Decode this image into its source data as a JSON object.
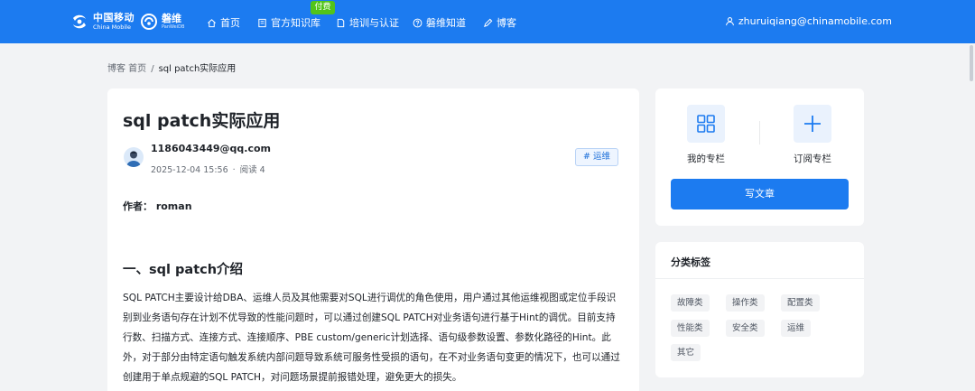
{
  "header": {
    "brand": {
      "cn": "中国移动",
      "en": "China Mobile"
    },
    "product": {
      "cn": "磐维",
      "en": "PanWeiDB"
    },
    "nav": [
      {
        "label": "首页",
        "icon": "home-icon"
      },
      {
        "label": "官方知识库",
        "icon": "book-icon",
        "badge": "付费"
      },
      {
        "label": "培训与认证",
        "icon": "document-icon"
      },
      {
        "label": "磐维知道",
        "icon": "question-icon"
      },
      {
        "label": "博客",
        "icon": "pen-icon"
      }
    ],
    "user_email": "zhuruiqiang@chinamobile.com"
  },
  "breadcrumb": [
    "博客 首页",
    "sql patch实际应用"
  ],
  "article": {
    "title": "sql patch实际应用",
    "author_account": "1186043449@qq.com",
    "date": "2025-12-04 15:56",
    "reads": "阅读 4",
    "tag": "# 运维",
    "byline": "作者： roman",
    "section_heading": "一、sql patch介绍",
    "paragraph": "SQL PATCH主要设计给DBA、运维人员及其他需要对SQL进行调优的角色使用，用户通过其他运维视图或定位手段识别到业务语句存在计划不优导致的性能问题时，可以通过创建SQL PATCH对业务语句进行基于Hint的调优。目前支持行数、扫描方式、连接方式、连接顺序、PBE custom/generic计划选择、语句级参数设置、参数化路径的Hint。此外，对于部分由特定语句触发系统内部问题导致系统可服务性受损的语句，在不对业务语句变更的情况下，也可以通过创建用于单点规避的SQL PATCH，对问题场景提前报错处理，避免更大的损失。"
  },
  "sidebar": {
    "my_column": "我的专栏",
    "subscribe_column": "订阅专栏",
    "write_button": "写文章",
    "categories_title": "分类标签",
    "categories": [
      "故障类",
      "操作类",
      "配置类",
      "性能类",
      "安全类",
      "运维",
      "其它"
    ]
  },
  "colors": {
    "primary": "#1c7bf0",
    "paid_badge": "#52c41a",
    "page_bg": "#f2f3f5"
  }
}
